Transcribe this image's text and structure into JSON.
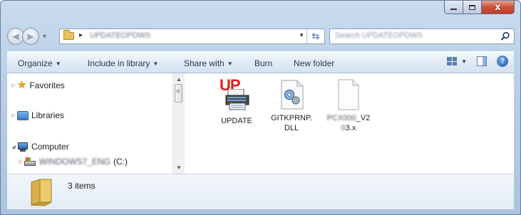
{
  "window": {
    "caption": {
      "minimize": "–",
      "close": "x"
    }
  },
  "nav": {
    "back_icon": "arrow-left",
    "forward_icon": "arrow-right",
    "address_text": "UPDATEOPDWS",
    "address_separator": "▸",
    "refresh_glyph": "⇆",
    "search_placeholder": "Search UPDATEOPDWS"
  },
  "toolbar": {
    "organize": "Organize",
    "include": "Include in library",
    "share": "Share with",
    "burn": "Burn",
    "new_folder": "New folder",
    "help": "?"
  },
  "navpane": {
    "favorites": "Favorites",
    "libraries": "Libraries",
    "computer": "Computer",
    "drive_name": "WINDOWS7_ENG",
    "drive_letter": "(C:)"
  },
  "files": [
    {
      "name_line1": "UPDATE",
      "name_line2": "",
      "badge": "UP",
      "icon": "printer-update-icon"
    },
    {
      "name_line1": "GITKPRNP.",
      "name_line2": "DLL",
      "icon": "dll-gear-icon"
    },
    {
      "name_line1_blur": "PCX000",
      "name_line1_tail": "_V2",
      "name_line2_blur": "0",
      "name_line2_tail": "3.x",
      "icon": "text-file-icon"
    }
  ],
  "details": {
    "count": "3 items"
  },
  "colors": {
    "accent": "#1e395b",
    "close_red": "#c03a22",
    "update_red": "#e0201b"
  }
}
